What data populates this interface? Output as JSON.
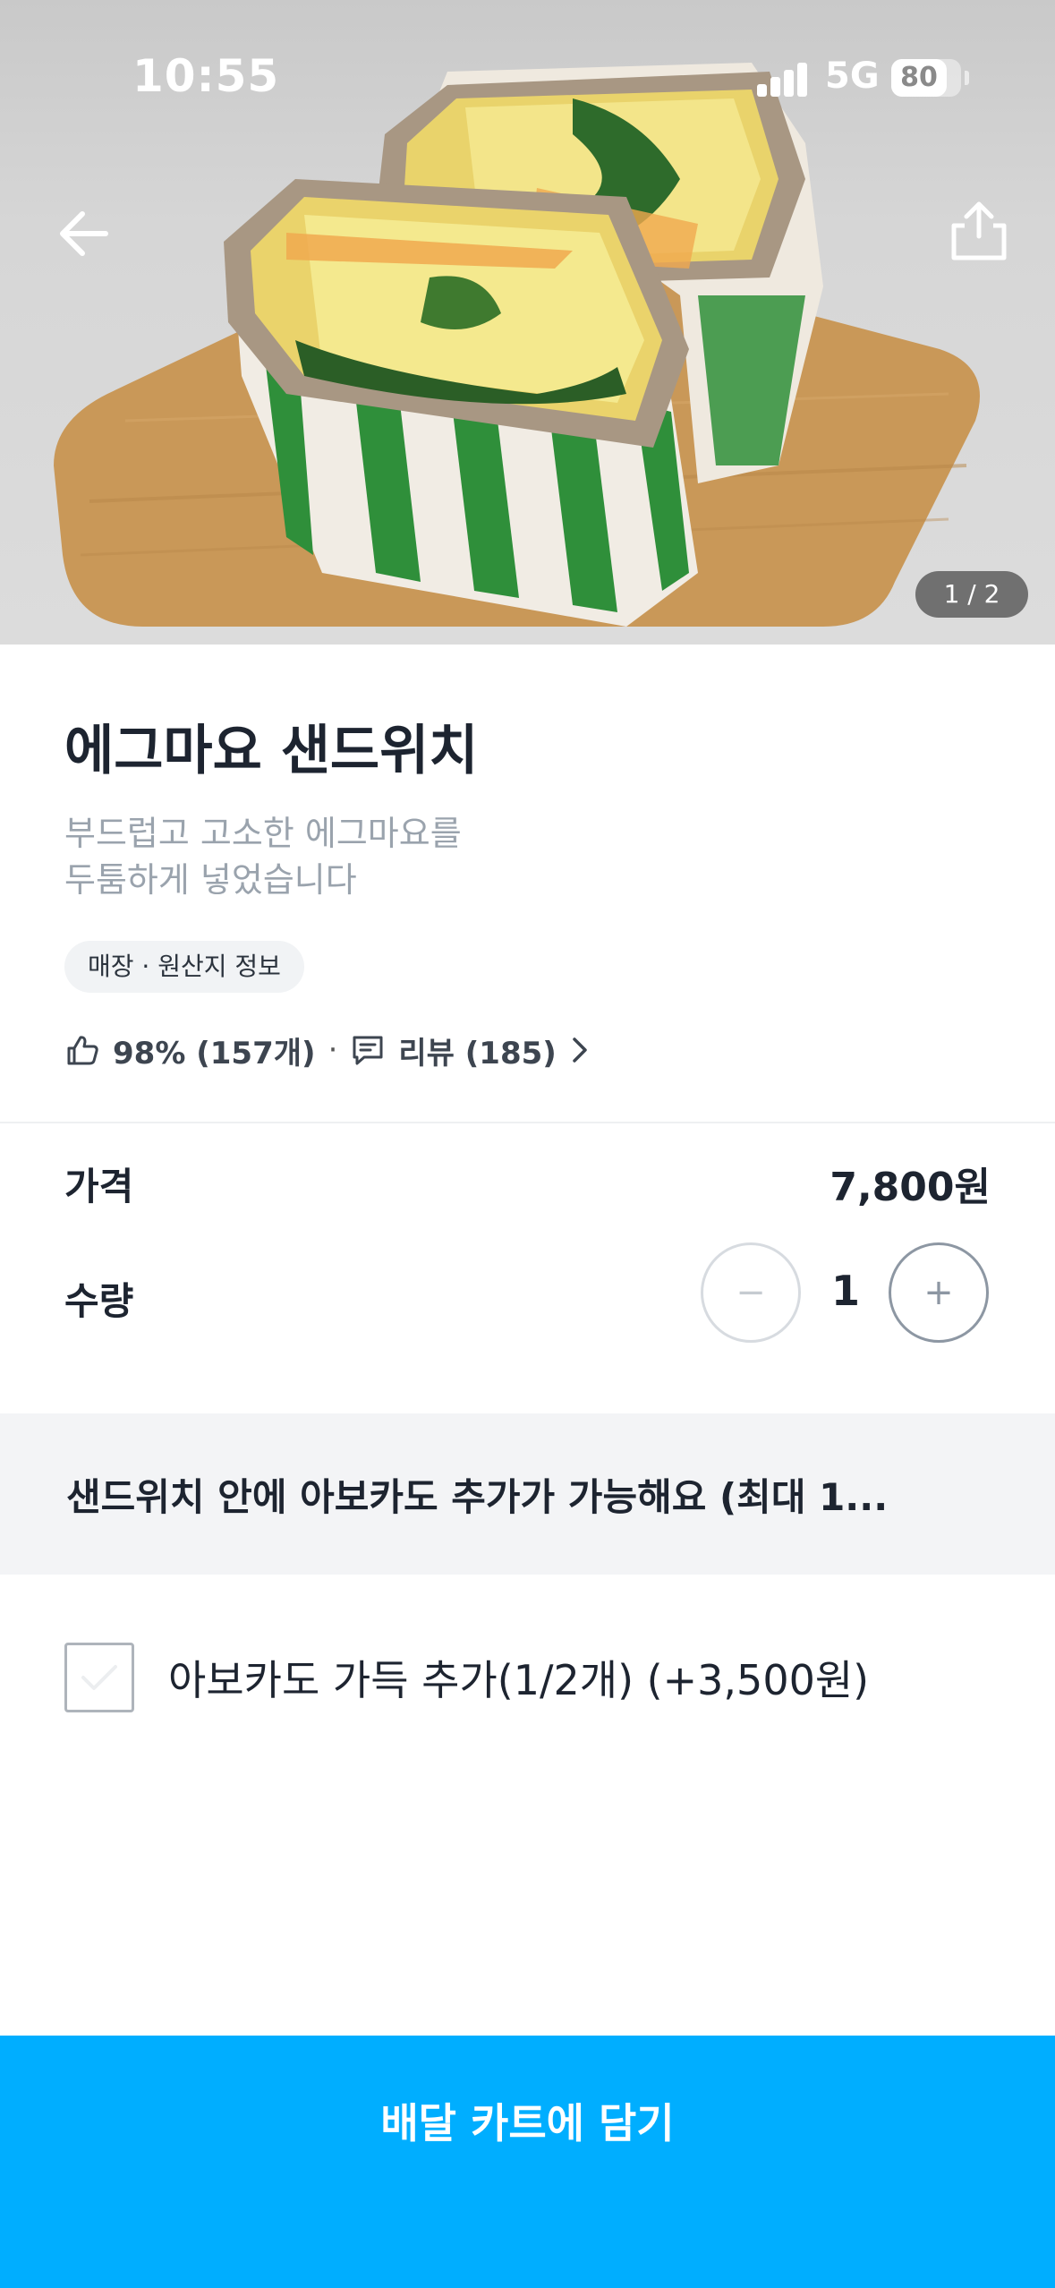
{
  "status_bar": {
    "time": "10:55",
    "network": "5G",
    "battery": "80"
  },
  "hero": {
    "image_subject": "egg mayo sandwich on wooden board",
    "page_indicator": "1 / 2",
    "back_icon": "arrow-left-icon",
    "share_icon": "share-icon"
  },
  "product": {
    "title": "에그마요 샌드위치",
    "description_lines": [
      "부드럽고 고소한 에그마요를",
      "두툼하게 넣었습니다"
    ],
    "info_tag": "매장 · 원산지 정보",
    "rating_text": "98% (157개)",
    "separator": "·",
    "review_text": "리뷰 (185)"
  },
  "order": {
    "price_label": "가격",
    "price_value": "7,800원",
    "quantity_label": "수량",
    "minus_symbol": "−",
    "quantity_value": "1",
    "plus_symbol": "+"
  },
  "options": {
    "header": "샌드위치 안에 아보카도 추가가 가능해요 (최대 1...",
    "items": [
      {
        "label": "아보카도 가득 추가(1/2개) (+3,500원)",
        "checked": false
      }
    ]
  },
  "cta": {
    "label": "배달 카트에 담기",
    "color": "#00aeff"
  }
}
